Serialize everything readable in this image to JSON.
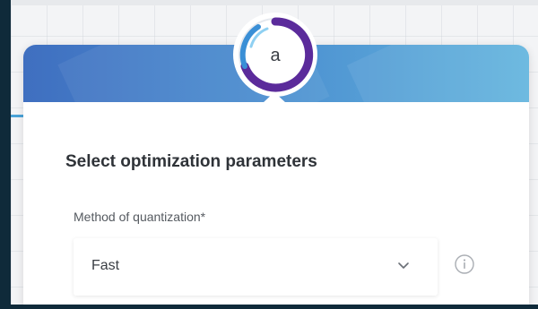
{
  "app": {
    "logo_letter": "a"
  },
  "form": {
    "section_title": "Select optimization parameters",
    "quantization": {
      "label": "Method of quantization*",
      "selected_value": "Fast"
    }
  },
  "colors": {
    "header_start": "#3f6fc0",
    "header_end": "#63b5de",
    "logo_ring_purple": "#5b2b9b",
    "logo_ring_blue": "#3a8fd6",
    "text_dark": "#2f3338",
    "sidebar_dark": "#0f2a3a"
  },
  "icons": {
    "select_caret": "chevron-down-icon",
    "help": "info-icon",
    "brand": "app-logo-icon"
  }
}
